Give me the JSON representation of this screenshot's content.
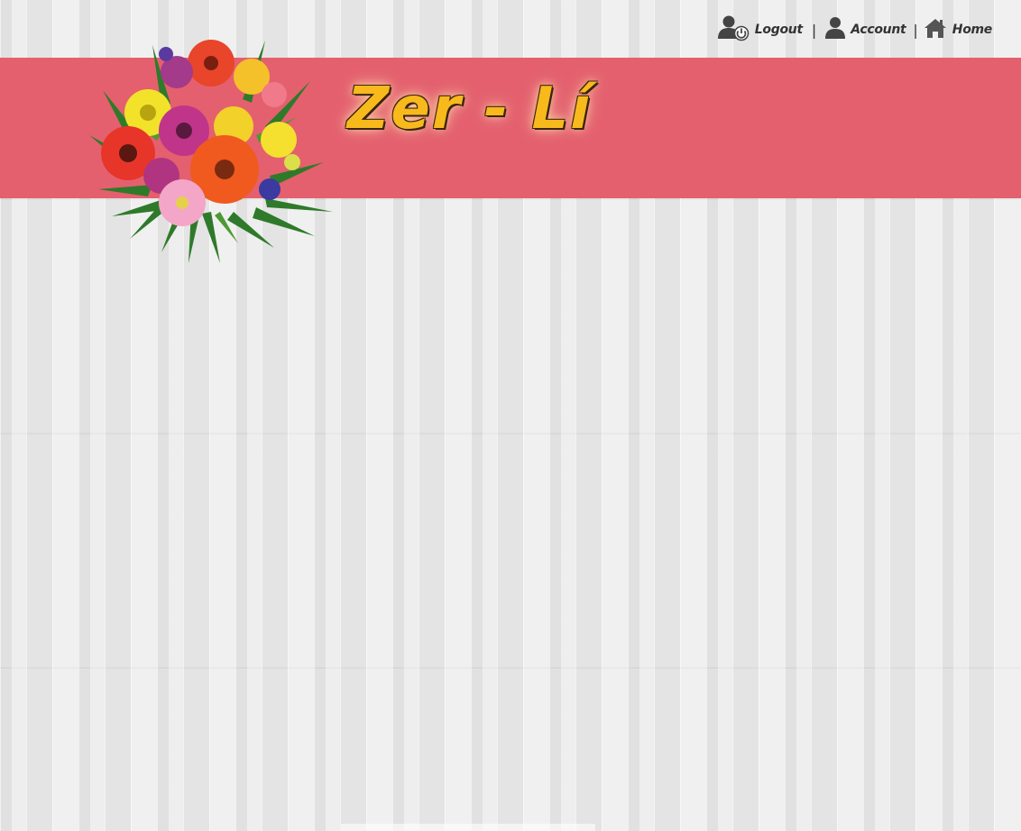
{
  "nav": {
    "logout_label": "Logout",
    "account_label": "Account",
    "home_label": "Home",
    "separator": "|"
  },
  "brand": {
    "title": "Zer - Lí"
  },
  "colors": {
    "banner": "#e4606e",
    "title": "#f7b91c",
    "title_outline": "#3a2410",
    "nav_text": "#333333",
    "background": "#e9e9e9"
  },
  "icons": {
    "logout": "user-power-icon",
    "account": "user-icon",
    "home": "home-icon",
    "bouquet": "flower-bouquet-image"
  }
}
